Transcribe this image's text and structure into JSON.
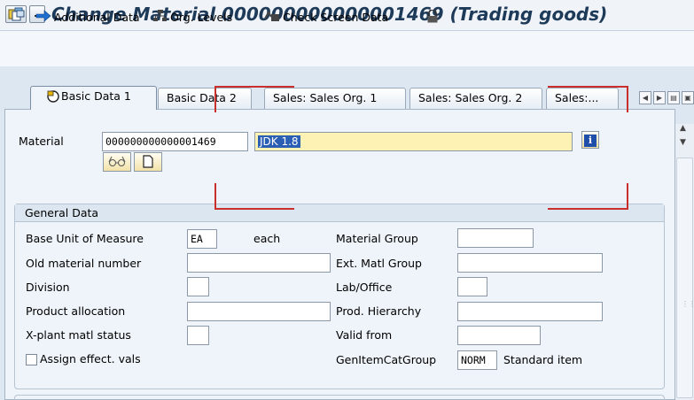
{
  "window": {
    "title": "Change Material 000000000000001469 (Trading goods)"
  },
  "toolbar": {
    "items": [
      {
        "label": ""
      },
      {
        "label": "Additional Data"
      },
      {
        "label": "Org. Levels"
      },
      {
        "label": "Check Screen Data"
      },
      {
        "label": ""
      }
    ]
  },
  "tabs": [
    {
      "label": "Basic Data 1",
      "active": true
    },
    {
      "label": "Basic Data 2"
    },
    {
      "label": "Sales: Sales Org. 1"
    },
    {
      "label": "Sales: Sales Org. 2"
    },
    {
      "label": "Sales:..."
    }
  ],
  "material": {
    "label": "Material",
    "number": "000000000000001469",
    "description": "JDK 1.8"
  },
  "general_data": {
    "title": "General Data",
    "left": [
      {
        "label": "Base Unit of Measure",
        "value": "EA",
        "text": "each"
      },
      {
        "label": "Old material number",
        "value": ""
      },
      {
        "label": "Division",
        "value": ""
      },
      {
        "label": "Product allocation",
        "value": ""
      },
      {
        "label": "X-plant matl status",
        "value": ""
      },
      {
        "label": "Assign effect. vals",
        "checked": false
      }
    ],
    "right": [
      {
        "label": "Material Group",
        "value": ""
      },
      {
        "label": "Ext. Matl Group",
        "value": ""
      },
      {
        "label": "Lab/Office",
        "value": ""
      },
      {
        "label": "Prod. Hierarchy",
        "value": ""
      },
      {
        "label": "Valid from",
        "value": ""
      },
      {
        "label": "GenItemCatGroup",
        "value": "NORM",
        "text": "Standard item"
      }
    ]
  },
  "colors": {
    "title": "#1e3a59",
    "highlight_field": "#fdf1b4",
    "annotation_red": "#c9302c"
  }
}
